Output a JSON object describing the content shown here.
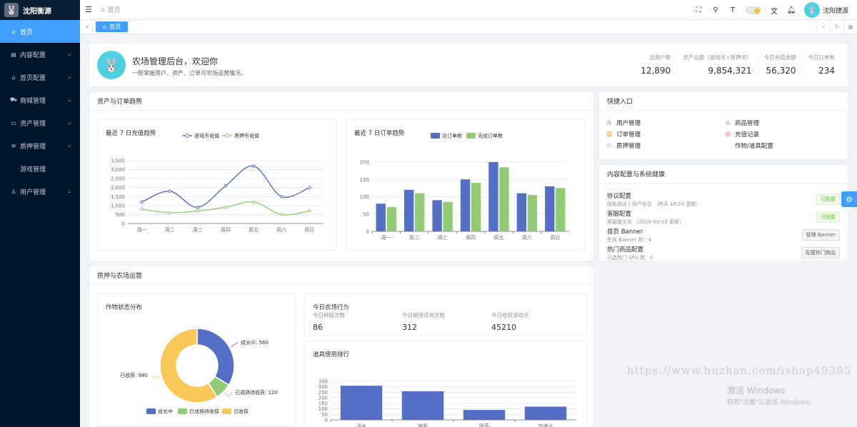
{
  "sidebar": {
    "brand": "沈阳衡源",
    "items": [
      {
        "label": "首页",
        "icon": "home-icon",
        "active": true
      },
      {
        "label": "内容配置",
        "icon": "document-icon",
        "expandable": true
      },
      {
        "label": "首页配置",
        "icon": "home-icon",
        "expandable": true
      },
      {
        "label": "商城管理",
        "icon": "cart-icon",
        "expandable": true
      },
      {
        "label": "资产管理",
        "icon": "folder-icon",
        "expandable": true
      },
      {
        "label": "质押管理",
        "icon": "database-icon",
        "expandable": true
      },
      {
        "label": "游戏管理",
        "sub": true
      },
      {
        "label": "用户管理",
        "icon": "user-icon",
        "expandable": true
      }
    ]
  },
  "header": {
    "breadcrumb": "首页",
    "username": "沈阳捷源"
  },
  "tags": {
    "active": "首页"
  },
  "welcome": {
    "title": "农场管理后台，欢迎你",
    "subtitle": "一眼掌握用户、资产、订单与农场运营情况。",
    "stats": [
      {
        "label": "总用户数",
        "value": "12,890"
      },
      {
        "label": "资产总额（游戏币+质押币）",
        "value": "9,854,321"
      },
      {
        "label": "今日充值金额",
        "value": "56,320"
      },
      {
        "label": "今日订单数",
        "value": "234"
      }
    ]
  },
  "assets_section": {
    "title": "资产与订单趋势"
  },
  "recharge_chart": {
    "title": "最近 7 日充值趋势",
    "chart_data": {
      "type": "line",
      "categories": [
        "周一",
        "周二",
        "周三",
        "周四",
        "周五",
        "周六",
        "周日"
      ],
      "series": [
        {
          "name": "游戏币充值",
          "values": [
            1200,
            1800,
            900,
            2100,
            3200,
            1500,
            2000
          ],
          "color": "#5470c6"
        },
        {
          "name": "质押币充值",
          "values": [
            800,
            600,
            700,
            900,
            1200,
            500,
            700
          ],
          "color": "#91cc75"
        }
      ],
      "ylim": [
        0,
        3500
      ],
      "yticks": [
        "0",
        "500",
        "1,000",
        "1,500",
        "2,000",
        "2,500",
        "3,000",
        "3,500"
      ]
    }
  },
  "order_chart": {
    "title": "最近 7 日订单趋势",
    "chart_data": {
      "type": "bar",
      "categories": [
        "周一",
        "周二",
        "周三",
        "周四",
        "周五",
        "周六",
        "周日"
      ],
      "series": [
        {
          "name": "总订单数",
          "values": [
            80,
            120,
            90,
            150,
            200,
            110,
            130
          ],
          "color": "#5470c6"
        },
        {
          "name": "完成订单数",
          "values": [
            70,
            110,
            85,
            140,
            185,
            105,
            125
          ],
          "color": "#91cc75"
        }
      ],
      "ylim": [
        0,
        200
      ],
      "yticks": [
        "0",
        "50",
        "100",
        "150",
        "200"
      ]
    }
  },
  "quick": {
    "title": "快捷入口",
    "items": [
      {
        "label": "用户管理",
        "icon": "user-icon",
        "color": "#409eff"
      },
      {
        "label": "商品管理",
        "icon": "shop-icon",
        "color": "#67c23a"
      },
      {
        "label": "订单管理",
        "icon": "clipboard-icon",
        "color": "#e6a23c"
      },
      {
        "label": "充值记录",
        "icon": "coin-icon",
        "color": "#f56c6c"
      },
      {
        "label": "质押管理",
        "icon": "star-icon",
        "color": "#9b59b6"
      },
      {
        "label": "作物/道具配置",
        "icon": "",
        "color": "#303133"
      }
    ]
  },
  "health": {
    "title": "内容配置与系统健康",
    "rows": [
      {
        "title": "协议配置",
        "sub": "隐私协议 / 用户协议 （昨天 18:20 更新）",
        "badge": "已配置",
        "kind": "ok"
      },
      {
        "title": "客服配置",
        "sub": "客服提文本 （2026-03-03 更新）",
        "badge": "已配置",
        "kind": "ok"
      },
      {
        "title": "首页 Banner",
        "sub": "生效 Banner 数：4",
        "badge": "管理 Banner",
        "kind": "btn"
      },
      {
        "title": "热门商品配置",
        "sub": "已选热门 SPU 数：0",
        "badge": "配置热门商品",
        "kind": "btn"
      }
    ]
  },
  "farm_section": {
    "title": "质押与农场运营"
  },
  "crop_chart": {
    "title": "作物状态分布",
    "chart_data": {
      "type": "pie",
      "labels": [
        "成长中",
        "已成熟待收获",
        "已收获"
      ],
      "values": [
        560,
        120,
        980
      ],
      "colors": [
        "#5470c6",
        "#91cc75",
        "#fac858"
      ],
      "label_texts": [
        "成长中: 560",
        "已成熟待收获: 120",
        "已收获: 980"
      ]
    }
  },
  "today": {
    "title": "今日农场行为",
    "metrics": [
      {
        "label": "今日种植次数",
        "value": "86"
      },
      {
        "label": "今日使用道具次数",
        "value": "312"
      },
      {
        "label": "今日收获游戏币",
        "value": "45210"
      }
    ]
  },
  "props_chart": {
    "title": "道具使用排行",
    "chart_data": {
      "type": "bar",
      "categories": [
        "浇水",
        "施肥",
        "除草",
        "加速卡"
      ],
      "values": [
        310,
        260,
        90,
        120
      ],
      "color": "#5470c6",
      "ylim": [
        0,
        350
      ],
      "yticks": [
        "0",
        "50",
        "100",
        "150",
        "200",
        "250",
        "300",
        "350"
      ]
    }
  },
  "watermark": "https://www.huzhan.com/ishop49385",
  "activation": {
    "line1": "激活 Windows",
    "line2": "转到\"设置\"以激活 Windows。"
  }
}
